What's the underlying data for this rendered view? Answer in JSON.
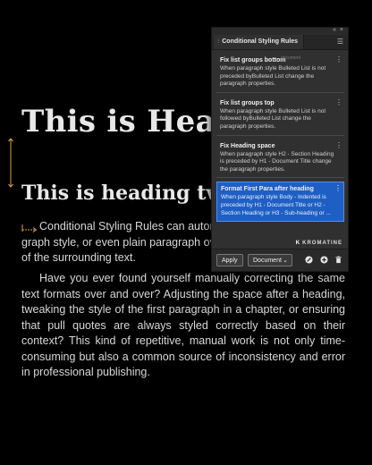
{
  "document": {
    "heading_one": "This is Head",
    "heading_two": "This is heading two",
    "paragraph_one": [
      "Conditional  Styling Rules can automa",
      "graph style, or even plain paragraph overrid",
      "of the surrounding text."
    ],
    "paragraph_two": "Have you ever found yourself manually correcting the same text formats over and over? Adjusting the space after a heading, tweaking the style of the first paragraph in a chapter, or ensuring that pull quotes are always styled correctly based on their context? This kind of repetitive, manual work is not only time-consuming but also a common source of inconsistency and error in professional publishing."
  },
  "panel": {
    "controls": "«  ×",
    "tab_title": "Conditional Styling Rules",
    "tab_grip": "⁝",
    "menu": "☰",
    "ghost_text": "document",
    "rules": [
      {
        "title": "Fix list groups bottom",
        "description": "When paragraph style Bulleted List is not preceded byBulleted List change the paragraph properties."
      },
      {
        "title": "Fix list groups top",
        "description": "When paragraph style Bulleted List is not followed byBulleted List change the paragraph properties."
      },
      {
        "title": "Fix Heading space",
        "description": "When paragraph style H2 - Section Heading is preceded by H1 - Document Title change the paragraph properties."
      },
      {
        "title": "Format First Para after heading",
        "description": "When paragraph style Body - Indented is preceded by H1 - Document Title or H2 - Section Heading or H3 - Sub-heading or ..."
      }
    ],
    "kebab": "⋮",
    "brand": "KROMATINE",
    "brand_mark": "K",
    "footer": {
      "apply_label": "Apply",
      "scope_value": "Document",
      "scope_chevron": "⌄"
    }
  },
  "colors": {
    "accent_selected": "#1f5fc4",
    "panel_bg": "#303030",
    "canvas_bg": "#000000"
  }
}
